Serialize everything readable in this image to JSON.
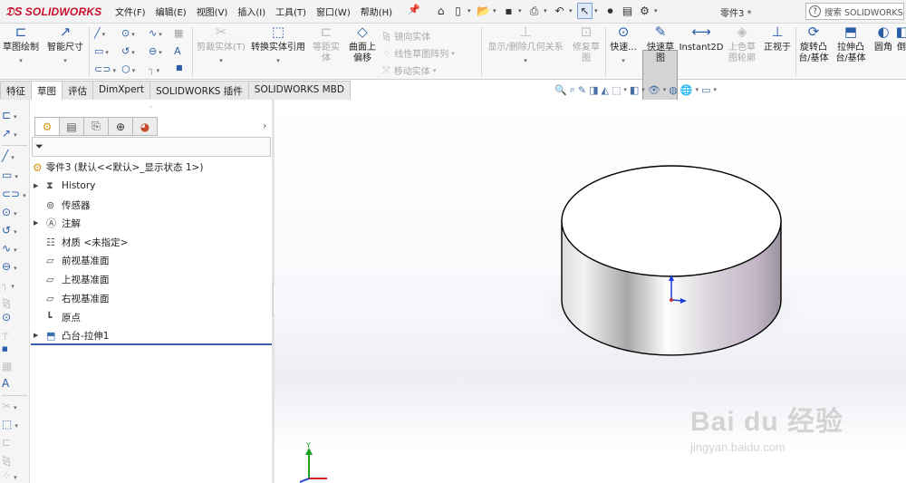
{
  "app": {
    "logo_text": "SOLIDWORKS",
    "document_title": "零件3 *"
  },
  "menu": [
    "文件(F)",
    "编辑(E)",
    "视图(V)",
    "插入(I)",
    "工具(T)",
    "窗口(W)",
    "帮助(H)"
  ],
  "search": {
    "placeholder": "搜索 SOLIDWORKS"
  },
  "ribbon": {
    "sketch": "草图绘制",
    "smart_dim": "智能尺寸",
    "trim": "剪裁实体(T)",
    "convert": "转换实体引用",
    "offset": "等距实体",
    "surface_offset": "曲面上偏移",
    "mirror": "镜向实体",
    "linear_pattern": "线性草图阵列",
    "move": "移动实体",
    "display_delete": "显示/删除几何关系",
    "repair": "修复草图",
    "quick_snaps": "快速...",
    "rapid_sketch": "快速草图",
    "instant2d": "Instant2D",
    "shaded_sketch": "上色草图轮廓",
    "normal_to": "正视于",
    "revolve_boss": "旋转凸台/基体",
    "extrude_boss": "拉伸凸台/基体",
    "fillet": "圆角",
    "more": "倒"
  },
  "tabs": [
    "特征",
    "草图",
    "评估",
    "DimXpert",
    "SOLIDWORKS 插件",
    "SOLIDWORKS MBD"
  ],
  "tree": {
    "root": "零件3  (默认<<默认>_显示状态 1>)",
    "items": [
      {
        "label": "History",
        "icon": "history-icon",
        "expand": true
      },
      {
        "label": "传感器",
        "icon": "sensor-icon",
        "expand": false
      },
      {
        "label": "注解",
        "icon": "annotation-icon",
        "expand": true
      },
      {
        "label": "材质 <未指定>",
        "icon": "material-icon",
        "expand": false
      },
      {
        "label": "前视基准面",
        "icon": "plane-icon",
        "expand": false
      },
      {
        "label": "上视基准面",
        "icon": "plane-icon",
        "expand": false
      },
      {
        "label": "右视基准面",
        "icon": "plane-icon",
        "expand": false
      },
      {
        "label": "原点",
        "icon": "origin-icon",
        "expand": false
      },
      {
        "label": "凸台-拉伸1",
        "icon": "extrude-icon",
        "expand": true
      }
    ]
  },
  "watermark": {
    "brand": "Bai  du 经验",
    "url": "jingyan.baidu.com"
  },
  "colors": {
    "accent": "#2a5fa8",
    "logo": "#c8102e",
    "tree_line": "#3d5fa8"
  }
}
